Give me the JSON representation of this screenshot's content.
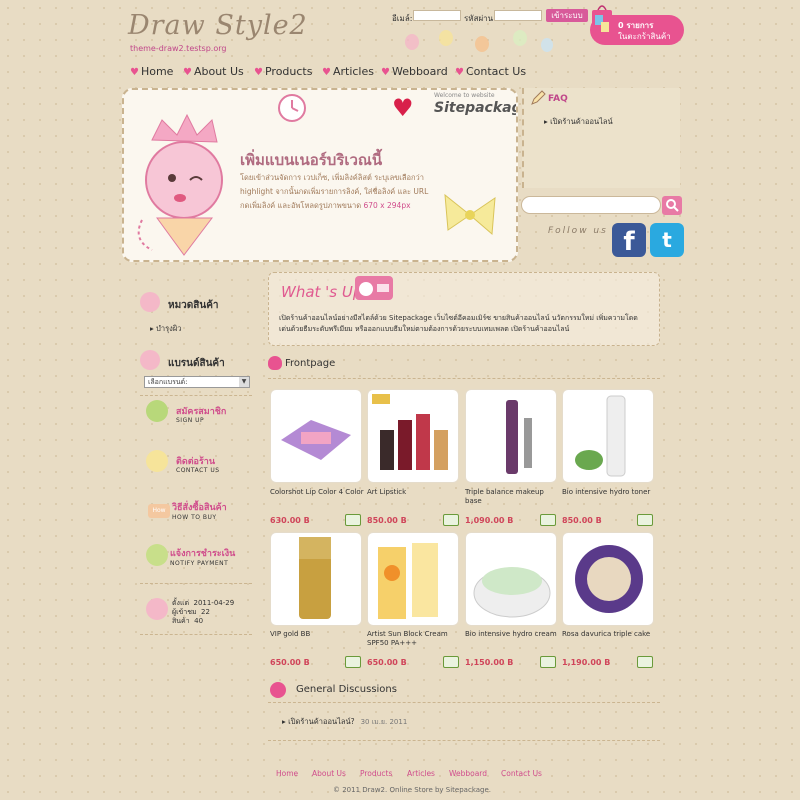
{
  "header": {
    "logo_title": "Draw Style2",
    "logo_sub": "theme-draw2.testsp.org",
    "login": {
      "email_label": "อีเมล์:",
      "password_label": "รหัสผ่าน:",
      "button": "เข้าระบบ"
    },
    "cart": {
      "count": "0 รายการ",
      "label": "ในตะกร้าสินค้า"
    }
  },
  "nav": [
    "Home",
    "About Us",
    "Products",
    "Articles",
    "Webboard",
    "Contact Us"
  ],
  "banner": {
    "brand": "Sitepackage",
    "welcome": "Welcome to website",
    "headline": "เพิ่มแบนเนอร์บริเวณนี้",
    "lines": [
      "โดยเข้าส่วนจัดการ เวปเก็ซ, เพิ่มลิงค์ลิสต์ ระบุเลขเลือกว่า",
      "highlight จากนั้นกดเพิ่มรายการลิงค์, ใส่ชื่อลิงค์ และ URL",
      "กดเพิ่มลิงค์ และอัพโหลดรูปภาพขนาด"
    ],
    "size": "670 x 294px"
  },
  "faq": {
    "title": "FAQ",
    "item": "เปิดร้านค้าออนไลน์"
  },
  "follow_label": "Follow us",
  "sidebar": {
    "category_head": "หมวดสินค้า",
    "category_item": "บำรุงผิว",
    "brand_head": "แบรนด์สินค้า",
    "brand_select": "เลือกแบรนด์:",
    "links": [
      {
        "th": "สมัครสมาชิก",
        "en": "SIGN UP"
      },
      {
        "th": "ติดต่อร้าน",
        "en": "CONTACT US"
      },
      {
        "th": "วิธีสั่งซื้อสินค้า",
        "en": "HOW TO BUY"
      },
      {
        "th": "แจ้งการชำระเงิน",
        "en": "NOTIFY PAYMENT"
      }
    ],
    "stats": [
      {
        "label": "ตั้งแต่",
        "value": "2011-04-29"
      },
      {
        "label": "ผู้เข้าชม",
        "value": "22"
      },
      {
        "label": "สินค้า",
        "value": "40"
      }
    ]
  },
  "whatsup": {
    "title": "What 's Up",
    "lines": [
      "เปิดร้านค้าออนไลน์อย่างมีสไตล์ด้วย Sitepackage เว็บไซต์อีคอมเมิร์ซ ขายสินค้าออนไลน์ นวัตกรรมใหม่ เพิ่มความโดด",
      "เด่นด้วยธีมระดับพรีเมียม หรือออกแบบธีมใหม่ตามต้องการด้วยระบบเทมเพลต เปิดร้านค้าออนไลน์"
    ]
  },
  "frontpage": {
    "title": "Frontpage",
    "products": [
      {
        "name": "Colorshot Lip Color 4 Color",
        "price": "630.00 B"
      },
      {
        "name": "Art Lipstick",
        "price": "850.00 B"
      },
      {
        "name": "Triple balance makeup base",
        "price": "1,090.00 B"
      },
      {
        "name": "Bio intensive hydro toner",
        "price": "850.00 B"
      },
      {
        "name": "VIP gold BB",
        "price": "650.00 B"
      },
      {
        "name": "Artist Sun Block Cream SPF50 PA+++",
        "price": "650.00 B"
      },
      {
        "name": "Bio intensive hydro cream",
        "price": "1,150.00 B"
      },
      {
        "name": "Rosa davurica triple cake",
        "price": "1,190.00 B"
      }
    ]
  },
  "discussions": {
    "title": "General Discussions",
    "item": "เปิดร้านค้าออนไลน์?",
    "date": "30 เม.ย. 2011"
  },
  "footer": {
    "links": [
      "Home",
      "About Us",
      "Products",
      "Articles",
      "Webboard",
      "Contact Us"
    ],
    "copyright": "© 2011 Draw2. Online Store by Sitepackage."
  },
  "colors": {
    "accent": "#e85390",
    "price": "#d0455a",
    "background": "#e8dcc4"
  }
}
